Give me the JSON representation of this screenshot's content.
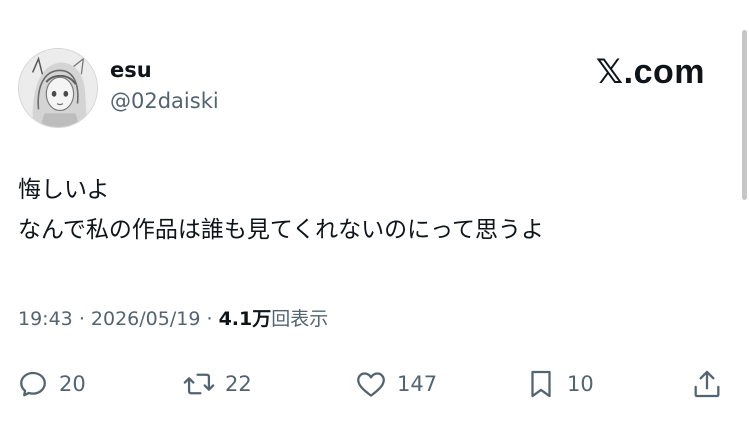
{
  "user": {
    "display_name": "esu",
    "handle": "@02daiski"
  },
  "brand": {
    "label": ".com",
    "x_mark": "𝕏"
  },
  "tweet": {
    "lines": [
      "悔しいよ",
      "なんで私の作品は誰も見てくれないのにって思うよ"
    ]
  },
  "meta": {
    "time": "19:43",
    "separator": "·",
    "date": "2026/05/19",
    "views_count": "4.1万",
    "views_label": "回表示"
  },
  "actions": {
    "reply": {
      "icon": "reply-icon",
      "count": "20"
    },
    "repost": {
      "icon": "repost-icon",
      "count": "22"
    },
    "like": {
      "icon": "heart-icon",
      "count": "147"
    },
    "bookmark": {
      "icon": "bookmark-icon",
      "count": "10"
    },
    "share": {
      "icon": "share-icon"
    }
  },
  "colors": {
    "text": "#0f1419",
    "secondary": "#536471",
    "background": "#ffffff"
  }
}
